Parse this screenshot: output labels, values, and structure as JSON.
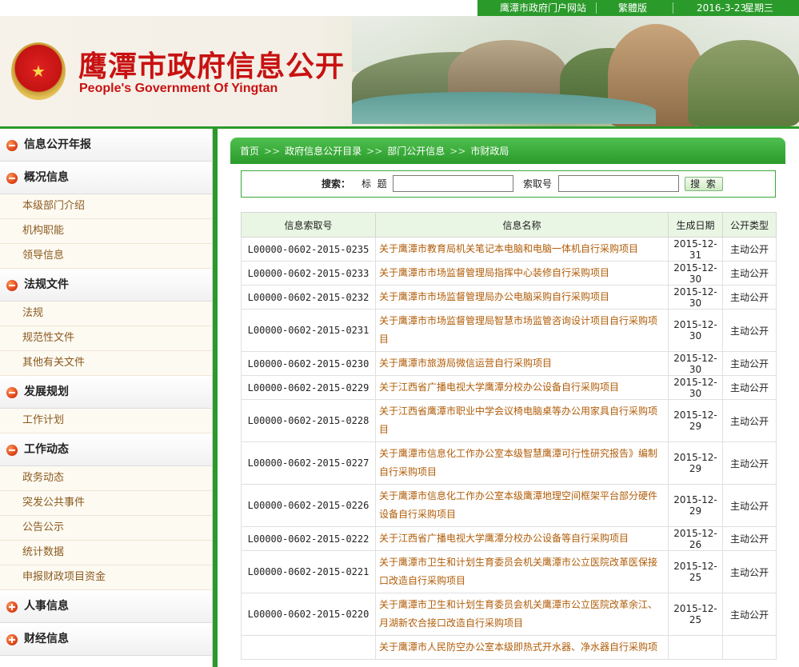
{
  "topbar": {
    "portal": "鹰潭市政府门户网站",
    "traditional": "繁體版",
    "date": "2016-3-23",
    "weekday": "星期三"
  },
  "banner": {
    "title": "鹰潭市政府信息公开",
    "subtitle": "People's Government Of Yingtan"
  },
  "sidebar": {
    "items": [
      {
        "label": "信息公开年报",
        "type": "cat",
        "icon": "minus"
      },
      {
        "label": "概况信息",
        "type": "cat",
        "icon": "minus"
      },
      {
        "label": "本级部门介绍",
        "type": "sub"
      },
      {
        "label": "机构职能",
        "type": "sub"
      },
      {
        "label": "领导信息",
        "type": "sub"
      },
      {
        "label": "法规文件",
        "type": "cat",
        "icon": "minus"
      },
      {
        "label": "法规",
        "type": "sub"
      },
      {
        "label": "规范性文件",
        "type": "sub"
      },
      {
        "label": "其他有关文件",
        "type": "sub"
      },
      {
        "label": "发展规划",
        "type": "cat",
        "icon": "minus"
      },
      {
        "label": "工作计划",
        "type": "sub"
      },
      {
        "label": "工作动态",
        "type": "cat",
        "icon": "minus"
      },
      {
        "label": "政务动态",
        "type": "sub"
      },
      {
        "label": "突发公共事件",
        "type": "sub"
      },
      {
        "label": "公告公示",
        "type": "sub"
      },
      {
        "label": "统计数据",
        "type": "sub"
      },
      {
        "label": "申报财政项目资金",
        "type": "sub"
      },
      {
        "label": "人事信息",
        "type": "cat",
        "icon": "plus"
      },
      {
        "label": "财经信息",
        "type": "cat",
        "icon": "plus"
      }
    ]
  },
  "breadcrumb": [
    "首页",
    "政府信息公开目录",
    "部门公开信息",
    "市财政局"
  ],
  "breadcrumb_sep": ">>",
  "search": {
    "label": "搜索：",
    "title_label": "标  题",
    "index_label": "索取号",
    "button": "搜 索"
  },
  "table": {
    "headers": [
      "信息索取号",
      "信息名称",
      "生成日期",
      "公开类型"
    ],
    "rows": [
      {
        "id": "L00000-0602-2015-0235",
        "name": "关于鹰潭市教育局机关笔记本电脑和电脑一体机自行采购项目",
        "date": "2015-12-31",
        "type": "主动公开"
      },
      {
        "id": "L00000-0602-2015-0233",
        "name": "关于鹰潭市市场监督管理局指挥中心装修自行采购项目",
        "date": "2015-12-30",
        "type": "主动公开"
      },
      {
        "id": "L00000-0602-2015-0232",
        "name": "关于鹰潭市市场监督管理局办公电脑采购自行采购项目",
        "date": "2015-12-30",
        "type": "主动公开"
      },
      {
        "id": "L00000-0602-2015-0231",
        "name": "关于鹰潭市市场监督管理局智慧市场监管咨询设计项目自行采购项目",
        "date": "2015-12-30",
        "type": "主动公开"
      },
      {
        "id": "L00000-0602-2015-0230",
        "name": "关于鹰潭市旅游局微信运营自行采购项目",
        "date": "2015-12-30",
        "type": "主动公开"
      },
      {
        "id": "L00000-0602-2015-0229",
        "name": "关于江西省广播电视大学鹰潭分校办公设备自行采购项目",
        "date": "2015-12-30",
        "type": "主动公开"
      },
      {
        "id": "L00000-0602-2015-0228",
        "name": "关于江西省鹰潭市职业中学会议椅电脑桌等办公用家具自行采购项目",
        "date": "2015-12-29",
        "type": "主动公开"
      },
      {
        "id": "L00000-0602-2015-0227",
        "name": "关于鹰潭市信息化工作办公室本级智慧鹰潭可行性研究报告》编制自行采购项目",
        "date": "2015-12-29",
        "type": "主动公开"
      },
      {
        "id": "L00000-0602-2015-0226",
        "name": "关于鹰潭市信息化工作办公室本级鹰潭地理空间框架平台部分硬件设备自行采购项目",
        "date": "2015-12-29",
        "type": "主动公开"
      },
      {
        "id": "L00000-0602-2015-0222",
        "name": "关于江西省广播电视大学鹰潭分校办公设备等自行采购项目",
        "date": "2015-12-26",
        "type": "主动公开"
      },
      {
        "id": "L00000-0602-2015-0221",
        "name": "关于鹰潭市卫生和计划生育委员会机关鹰潭市公立医院改革医保接口改造自行采购项目",
        "date": "2015-12-25",
        "type": "主动公开"
      },
      {
        "id": "L00000-0602-2015-0220",
        "name": "关于鹰潭市卫生和计划生育委员会机关鹰潭市公立医院改革余江、月湖新农合接口改造自行采购项目",
        "date": "2015-12-25",
        "type": "主动公开"
      },
      {
        "id": "",
        "name": "关于鹰潭市人民防空办公室本级即热式开水器、净水器自行采购项",
        "date": "",
        "type": ""
      }
    ]
  }
}
